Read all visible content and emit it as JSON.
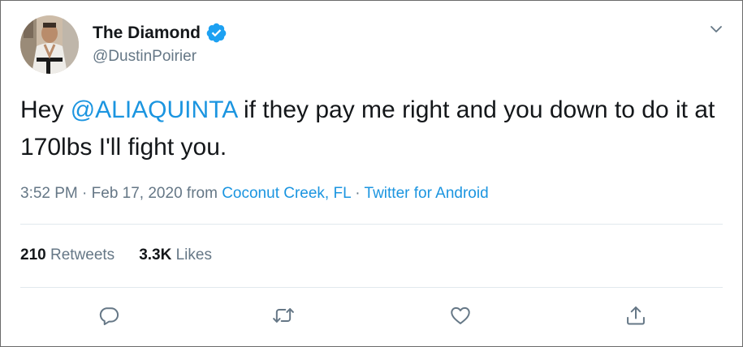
{
  "user": {
    "display_name": "The Diamond",
    "handle": "@DustinPoirier",
    "verified": true,
    "avatar": "profile-photo"
  },
  "tweet": {
    "text_before": "Hey ",
    "mention": "@ALIAQUINTA",
    "text_after": " if they pay me right and you down to do it at 170lbs I'll fight you."
  },
  "meta": {
    "time": "3:52 PM",
    "separator1": "·",
    "date": "Feb 17, 2020",
    "from": "from",
    "location": "Coconut Creek, FL",
    "separator2": "·",
    "source": "Twitter for Android"
  },
  "stats": {
    "retweets_count": "210",
    "retweets_label": "Retweets",
    "likes_count": "3.3K",
    "likes_label": "Likes"
  },
  "icons": {
    "verified": "verified-badge-icon",
    "caret": "chevron-down-icon",
    "reply": "reply-icon",
    "retweet": "retweet-icon",
    "like": "heart-icon",
    "share": "share-icon"
  },
  "colors": {
    "accent": "#1b95e0",
    "verified": "#1da1f2",
    "secondary_text": "#657786",
    "primary_text": "#14171a",
    "divider": "#e1e8ed"
  }
}
